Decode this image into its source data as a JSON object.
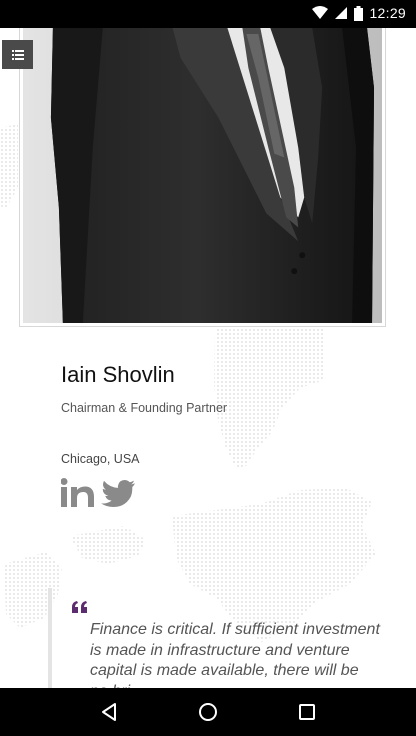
{
  "status_bar": {
    "time": "12:29",
    "icons": [
      "wifi-icon",
      "signal-icon",
      "battery-icon"
    ]
  },
  "menu": {
    "icon": "list-icon"
  },
  "profile": {
    "name": "Iain Shovlin",
    "title": "Chairman & Founding Partner",
    "location": "Chicago, USA",
    "social": [
      "linkedin-icon",
      "twitter-icon"
    ]
  },
  "quote": {
    "mark": "❝",
    "text": "Finance is critical. If sufficient investment is made in infrastructure and venture capital is made available, there will be no bri"
  },
  "nav": {
    "buttons": [
      "back-icon",
      "home-icon",
      "recents-icon"
    ]
  },
  "colors": {
    "quote_mark": "#5c2d6e",
    "social_icon": "#8a8a8a",
    "menu_bg": "#4a4a4a"
  }
}
